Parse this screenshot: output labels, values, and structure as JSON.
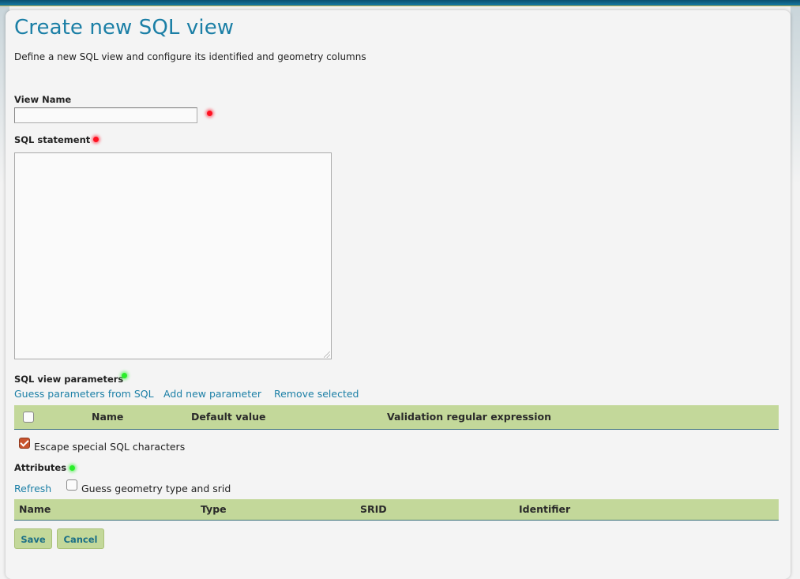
{
  "page": {
    "title": "Create new SQL view",
    "description": "Define a new SQL view and configure its identified and geometry columns"
  },
  "form": {
    "view_name_label": "View Name",
    "view_name_value": "",
    "sql_statement_label": "SQL statement",
    "sql_statement_value": ""
  },
  "parameters": {
    "label": "SQL view parameters",
    "links": {
      "guess": "Guess parameters from SQL",
      "add": "Add new parameter",
      "remove": "Remove selected"
    },
    "columns": [
      "Name",
      "Default value",
      "Validation regular expression"
    ],
    "rows": [],
    "escape_label": "Escape special SQL characters",
    "escape_checked": true
  },
  "attributes": {
    "label": "Attributes",
    "refresh": "Refresh",
    "guess_label": "Guess geometry type and srid",
    "guess_checked": false,
    "columns": [
      "Name",
      "Type",
      "SRID",
      "Identifier"
    ],
    "rows": []
  },
  "buttons": {
    "save": "Save",
    "cancel": "Cancel"
  },
  "colors": {
    "accent": "#1b7fa6",
    "header_green": "#c3d89a",
    "required": "#ff1020",
    "optional": "#2aee2a",
    "checkbox_checked": "#c8542e"
  }
}
